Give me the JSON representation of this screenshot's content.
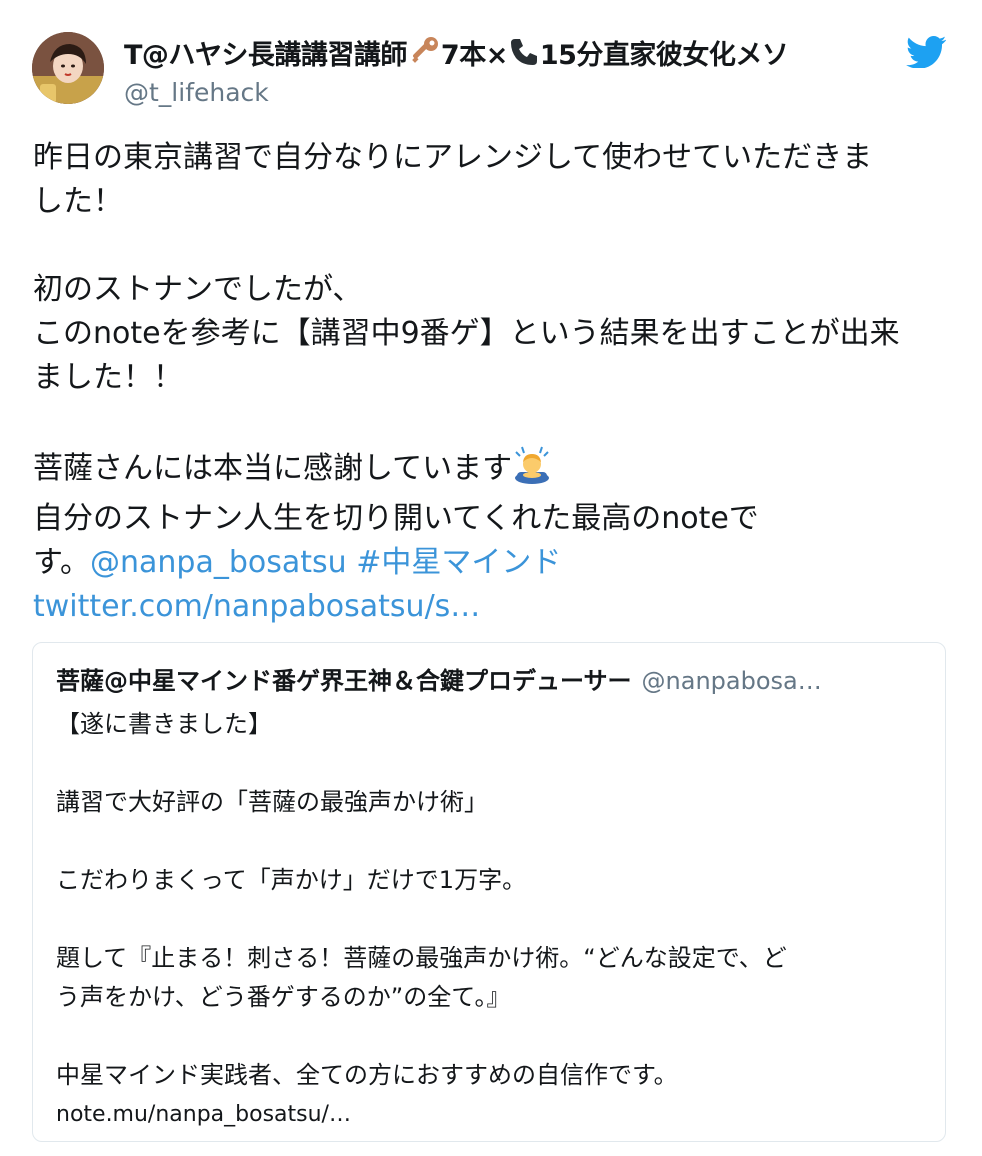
{
  "author": {
    "name": "T@ハヤシ長講講習講師",
    "name_suffix_1": "7本×",
    "name_suffix_2": "15分直家彼女化メソ",
    "handle": "@t_lifehack"
  },
  "icons": {
    "key": "key-icon",
    "phone": "telephone-icon",
    "twitter": "twitter-bird-icon",
    "bowing": "person-bowing-icon",
    "avatar": "avatar"
  },
  "colors": {
    "link": "#3b94d9",
    "twitter_blue": "#1da1f2",
    "secondary_text": "#657786",
    "border": "#e1e8ed"
  },
  "tweet": {
    "line1": "昨日の東京講習で自分なりにアレンジして使わせていただきま",
    "line2": "した！",
    "line3": "初のストナンでしたが、",
    "line4": "このnoteを参考に【講習中9番ゲ】という結果を出すことが出来",
    "line5": "ました！！",
    "line6": "菩薩さんには本当に感謝しています",
    "line7": "自分のストナン人生を切り開いてくれた最高のnoteで",
    "line8": "す。",
    "mention": "@nanpa_bosatsu",
    "hashtag": "#中星マインド",
    "url": "twitter.com/nanpabosatsu/s…"
  },
  "quoted": {
    "name": "菩薩@中星マインド番ゲ界王神＆合鍵プロデューサー",
    "handle": "@nanpabosa…",
    "line1": "【遂に書きました】",
    "line2": "講習で大好評の「菩薩の最強声かけ術」",
    "line3": "こだわりまくって「声かけ」だけで1万字。",
    "line4": "題して『止まる！刺さる！菩薩の最強声かけ術。“どんな設定で、ど",
    "line5": "う声をかけ、どう番ゲするのか”の全て。』",
    "line6": "中星マインド実践者、全ての方におすすめの自信作です。",
    "url": "note.mu/nanpa_bosatsu/…"
  }
}
